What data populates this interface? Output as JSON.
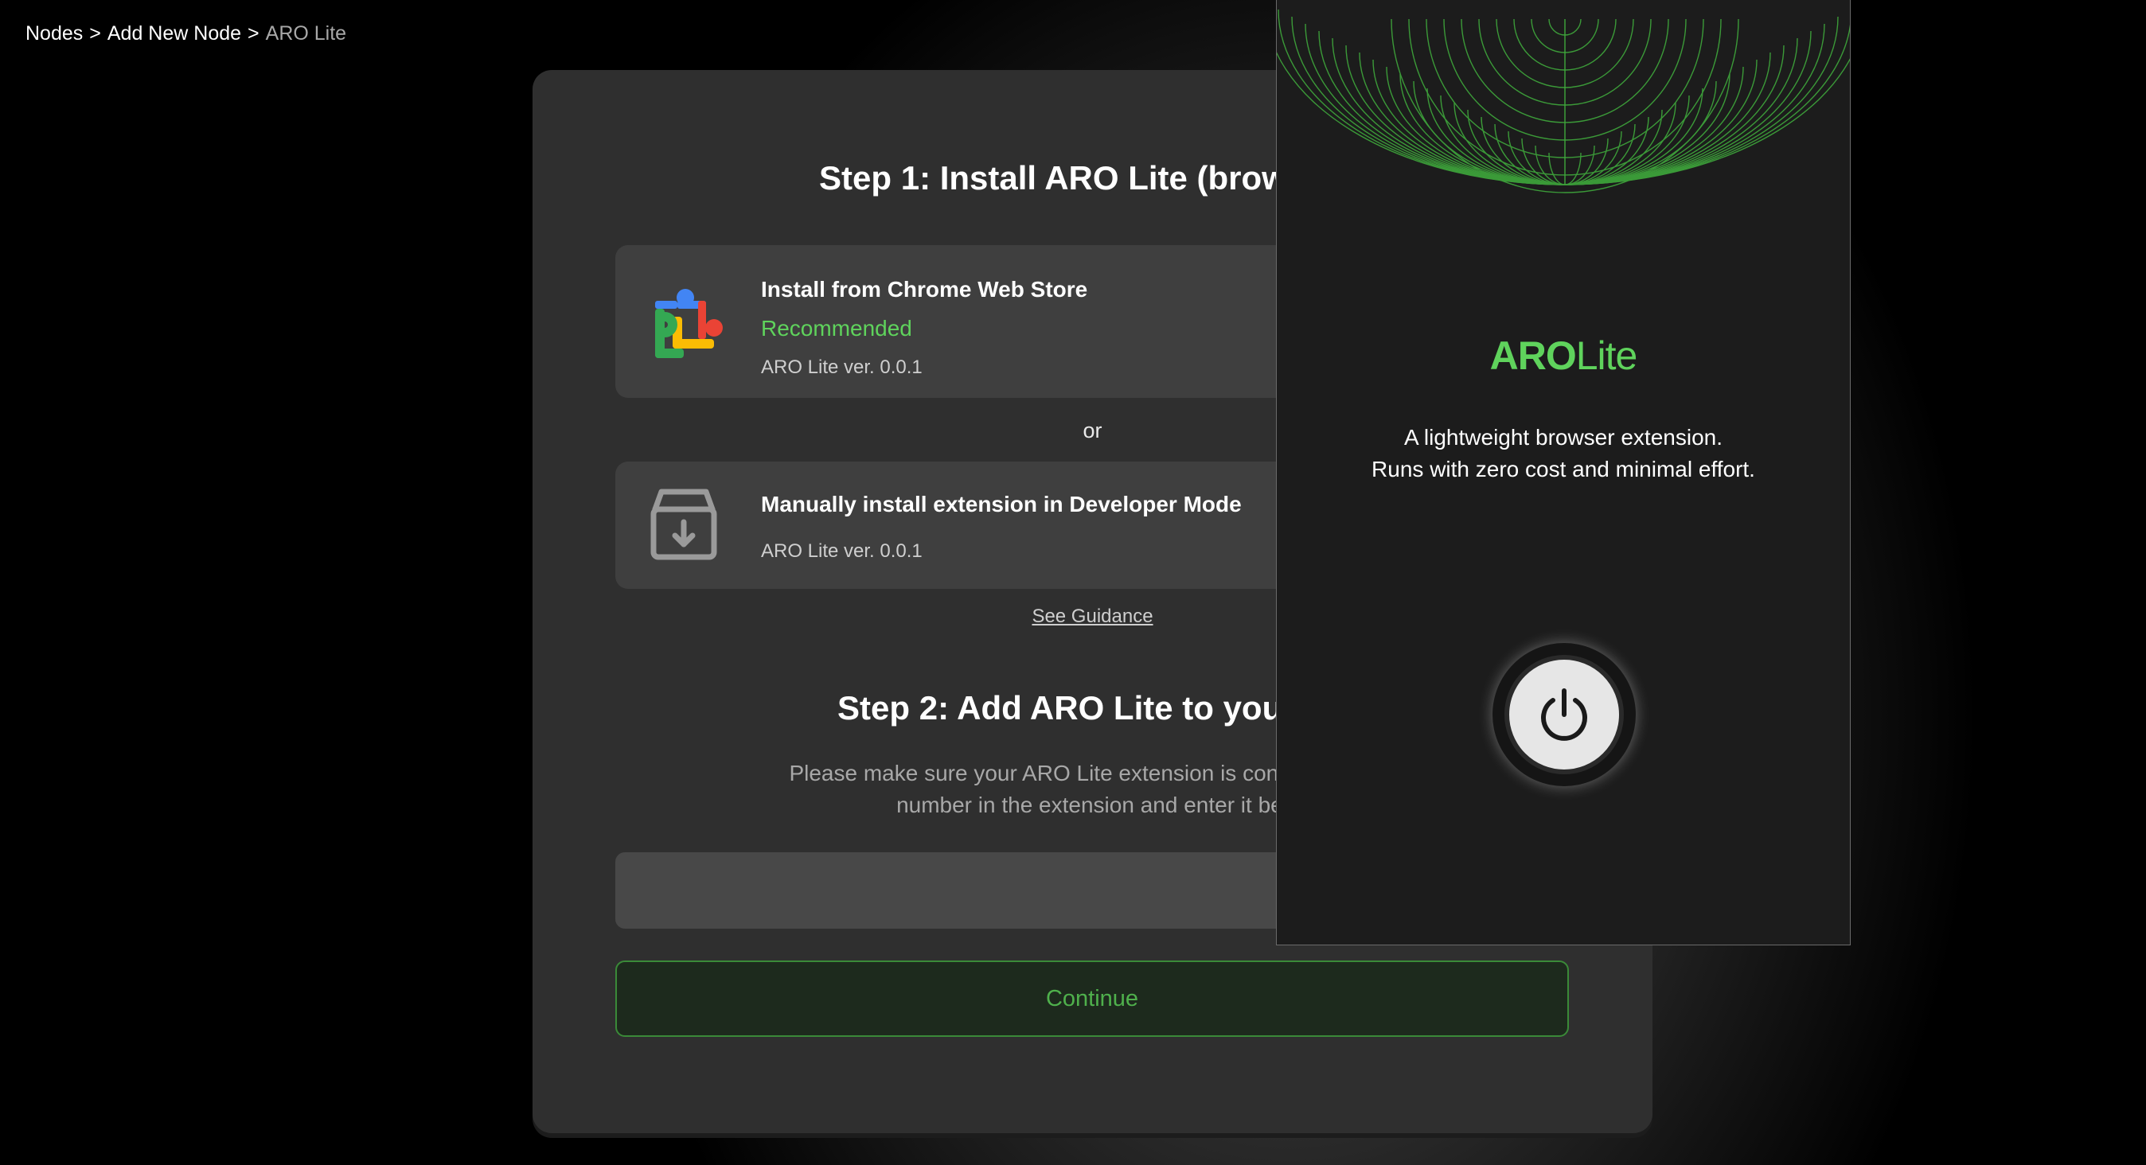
{
  "breadcrumb": {
    "items": [
      "Nodes",
      "Add New Node",
      "ARO Lite"
    ],
    "separator": ">"
  },
  "step1": {
    "title": "Step 1: Install ARO Lite (browser e",
    "option_store": {
      "title": "Install from Chrome Web Store",
      "badge": "Recommended",
      "version": "ARO Lite ver. 0.0.1",
      "icon": "chrome-web-store-puzzle-icon"
    },
    "or": "or",
    "option_manual": {
      "title": "Manually install extension in Developer Mode",
      "version": "ARO Lite ver. 0.0.1",
      "icon": "download-box-icon"
    },
    "guidance_link": "See Guidance"
  },
  "step2": {
    "title": "Step 2: Add ARO Lite to your Da",
    "instruction_line1": "Please make sure your ARO Lite extension is connected to th",
    "instruction_line2": "number in the extension and enter it bel",
    "input_value": "",
    "continue_label": "Continue"
  },
  "popup": {
    "logo_aro": "ARO",
    "logo_lite": "Lite",
    "desc_line1": "A lightweight browser extension.",
    "desc_line2": "Runs with zero cost and minimal effort.",
    "power_icon": "power-icon"
  },
  "colors": {
    "accent_green": "#5fd35c",
    "card_bg": "#2f2f2f",
    "option_bg": "#3f3f3f",
    "popup_bg": "#1c1c1c"
  }
}
